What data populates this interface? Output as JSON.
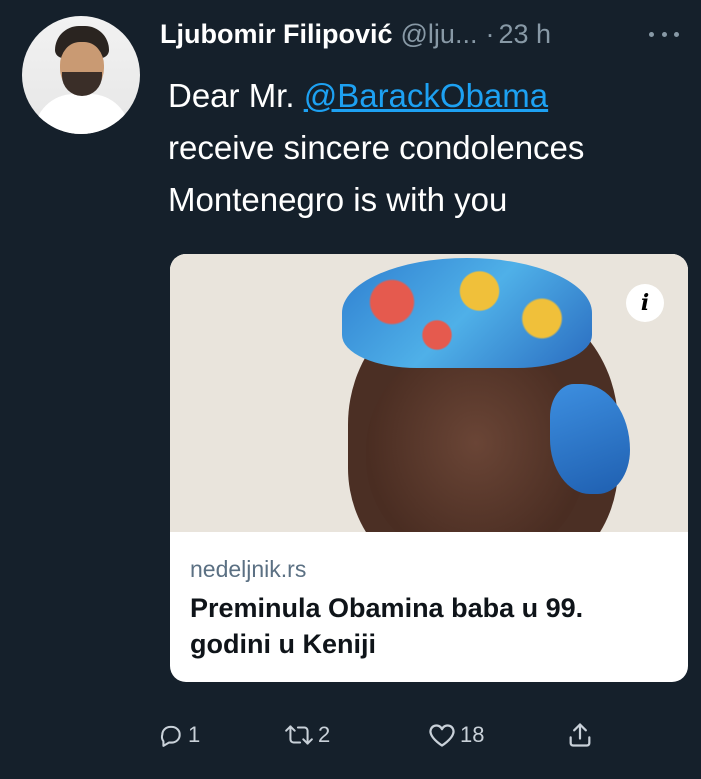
{
  "user": {
    "display_name": "Ljubomir Filipović",
    "handle": "@lju...",
    "separator": "·",
    "time": "23 h"
  },
  "tweet": {
    "line1_prefix": "Dear Mr. ",
    "mention": "@BarackObama",
    "line2": "receive sincere condolences",
    "line3": "Montenegro is with you"
  },
  "card": {
    "domain": "nedeljnik.rs",
    "title": "Preminula Obamina baba u 99. godini u Keniji",
    "info_icon_glyph": "i"
  },
  "actions": {
    "reply_count": "1",
    "retweet_count": "2",
    "like_count": "18"
  },
  "colors": {
    "background": "#15202b",
    "link": "#1da1f2",
    "secondary_text": "#8899a6"
  },
  "icons": [
    "more-icon",
    "info-icon",
    "reply-icon",
    "retweet-icon",
    "like-icon",
    "share-icon"
  ]
}
